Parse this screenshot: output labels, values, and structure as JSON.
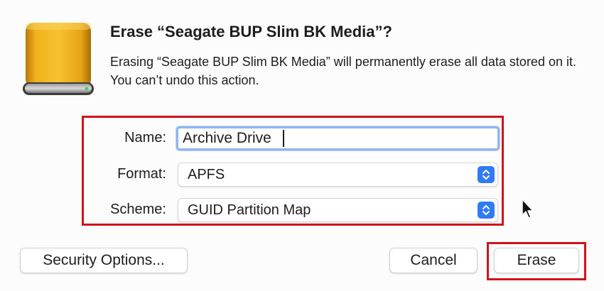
{
  "dialog": {
    "title": "Erase “Seagate BUP Slim BK Media”?",
    "message": "Erasing “Seagate BUP Slim BK Media” will permanently erase all data stored on it. You can’t undo this action.",
    "icon": "external-drive-icon"
  },
  "form": {
    "name_label": "Name:",
    "name_value": "Archive Drive",
    "format_label": "Format:",
    "format_value": "APFS",
    "scheme_label": "Scheme:",
    "scheme_value": "GUID Partition Map",
    "stepper_icon": "up-down-chevron-icon"
  },
  "buttons": {
    "security_options": "Security Options...",
    "cancel": "Cancel",
    "erase": "Erase"
  },
  "colors": {
    "highlight_red": "#d0121b",
    "accent_blue": "#2f7bf6",
    "drive_gold": "#e2a20f",
    "focus_ring": "#8fb5ef"
  }
}
